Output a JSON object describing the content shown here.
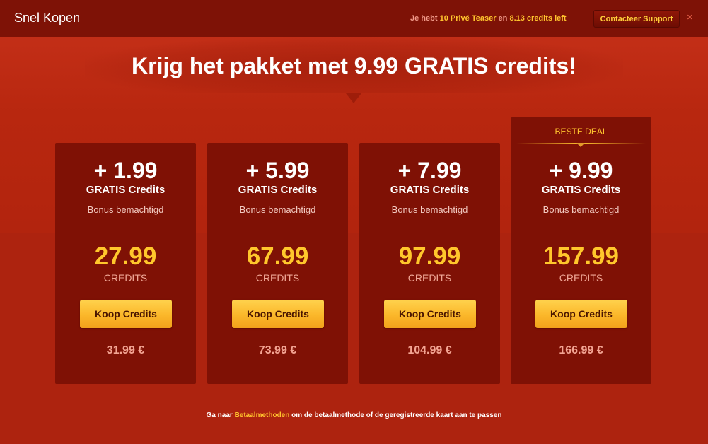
{
  "window": {
    "title": "Snel Kopen",
    "status": {
      "prefix": "Je hebt",
      "count": "10 Privé Teaser",
      "mid": "en",
      "credits": "8.13 credits left"
    },
    "support_label": "Contacteer Support",
    "close_glyph": "×"
  },
  "headline": "Krijg het pakket met 9.99 GRATIS credits!",
  "best_deal_label": "BESTE DEAL",
  "packages": [
    {
      "bonus": "+ 1.99",
      "gratis": "GRATIS Credits",
      "bonus_text": "Bonus bemachtigd",
      "credits": "27.99",
      "credits_word": "CREDITS",
      "button": "Koop Credits",
      "price": "31.99 €"
    },
    {
      "bonus": "+ 5.99",
      "gratis": "GRATIS Credits",
      "bonus_text": "Bonus bemachtigd",
      "credits": "67.99",
      "credits_word": "CREDITS",
      "button": "Koop Credits",
      "price": "73.99 €"
    },
    {
      "bonus": "+ 7.99",
      "gratis": "GRATIS Credits",
      "bonus_text": "Bonus bemachtigd",
      "credits": "97.99",
      "credits_word": "CREDITS",
      "button": "Koop Credits",
      "price": "104.99 €"
    },
    {
      "bonus": "+ 9.99",
      "gratis": "GRATIS Credits",
      "bonus_text": "Bonus bemachtigd",
      "credits": "157.99",
      "credits_word": "CREDITS",
      "button": "Koop Credits",
      "price": "166.99 €"
    }
  ],
  "footer": {
    "before": "Ga naar",
    "link": "Betaalmethoden",
    "after": "om de betaalmethode of de geregistreerde kaart aan te passen"
  },
  "colors": {
    "background": "#b8270f",
    "topbar": "#7e1206",
    "card": "#7f1105",
    "accent": "#ffc42e",
    "button": "#fbb72a"
  }
}
